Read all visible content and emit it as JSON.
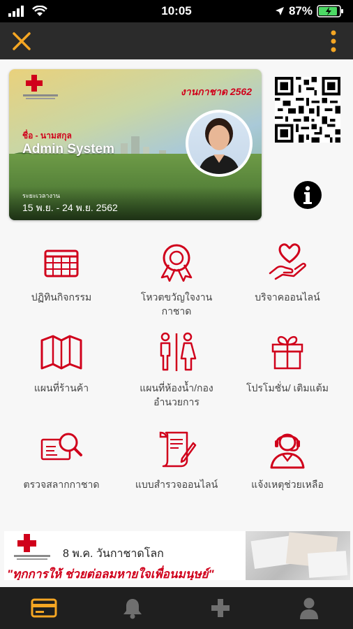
{
  "status_bar": {
    "time": "10:05",
    "battery": "87%"
  },
  "app": {
    "accent_color": "#f5a623",
    "brand_red": "#d0001b"
  },
  "card": {
    "event_title": "งานกาชาด 2562",
    "name_label": "ชื่อ - นามสกุล",
    "name": "Admin System",
    "period_label": "ระยะเวลางาน",
    "period": "15 พ.ย. - 24 พ.ย. 2562"
  },
  "menu": {
    "items": [
      {
        "label": "ปฏิทินกิจกรรม",
        "icon": "calendar-icon"
      },
      {
        "label": "โหวตขวัญใจงานกาชาด",
        "icon": "ribbon-award-icon"
      },
      {
        "label": "บริจาคออนไลน์",
        "icon": "heart-hand-icon"
      },
      {
        "label": "แผนที่ร้านค้า",
        "icon": "map-icon"
      },
      {
        "label": "แผนที่ห้องน้ำ/กองอำนวยการ",
        "icon": "restroom-icon"
      },
      {
        "label": "โปรโมชั่น/ เติมแต้ม",
        "icon": "gift-icon"
      },
      {
        "label": "ตรวจสลากกาชาด",
        "icon": "lottery-search-icon"
      },
      {
        "label": "แบบสำรวจออนไลน์",
        "icon": "survey-scroll-icon"
      },
      {
        "label": "แจ้งเหตุช่วยเหลือ",
        "icon": "support-agent-icon"
      }
    ]
  },
  "banner": {
    "title": "8 พ.ค. วันกาชาดโลก",
    "slogan": "\"ทุกการให้ ช่วยต่อลมหายใจเพื่อนมนุษย์\""
  },
  "bottom_nav": {
    "items": [
      {
        "icon": "card-icon",
        "active": true
      },
      {
        "icon": "bell-icon",
        "active": false
      },
      {
        "icon": "plus-icon",
        "active": false
      },
      {
        "icon": "user-icon",
        "active": false
      }
    ]
  }
}
